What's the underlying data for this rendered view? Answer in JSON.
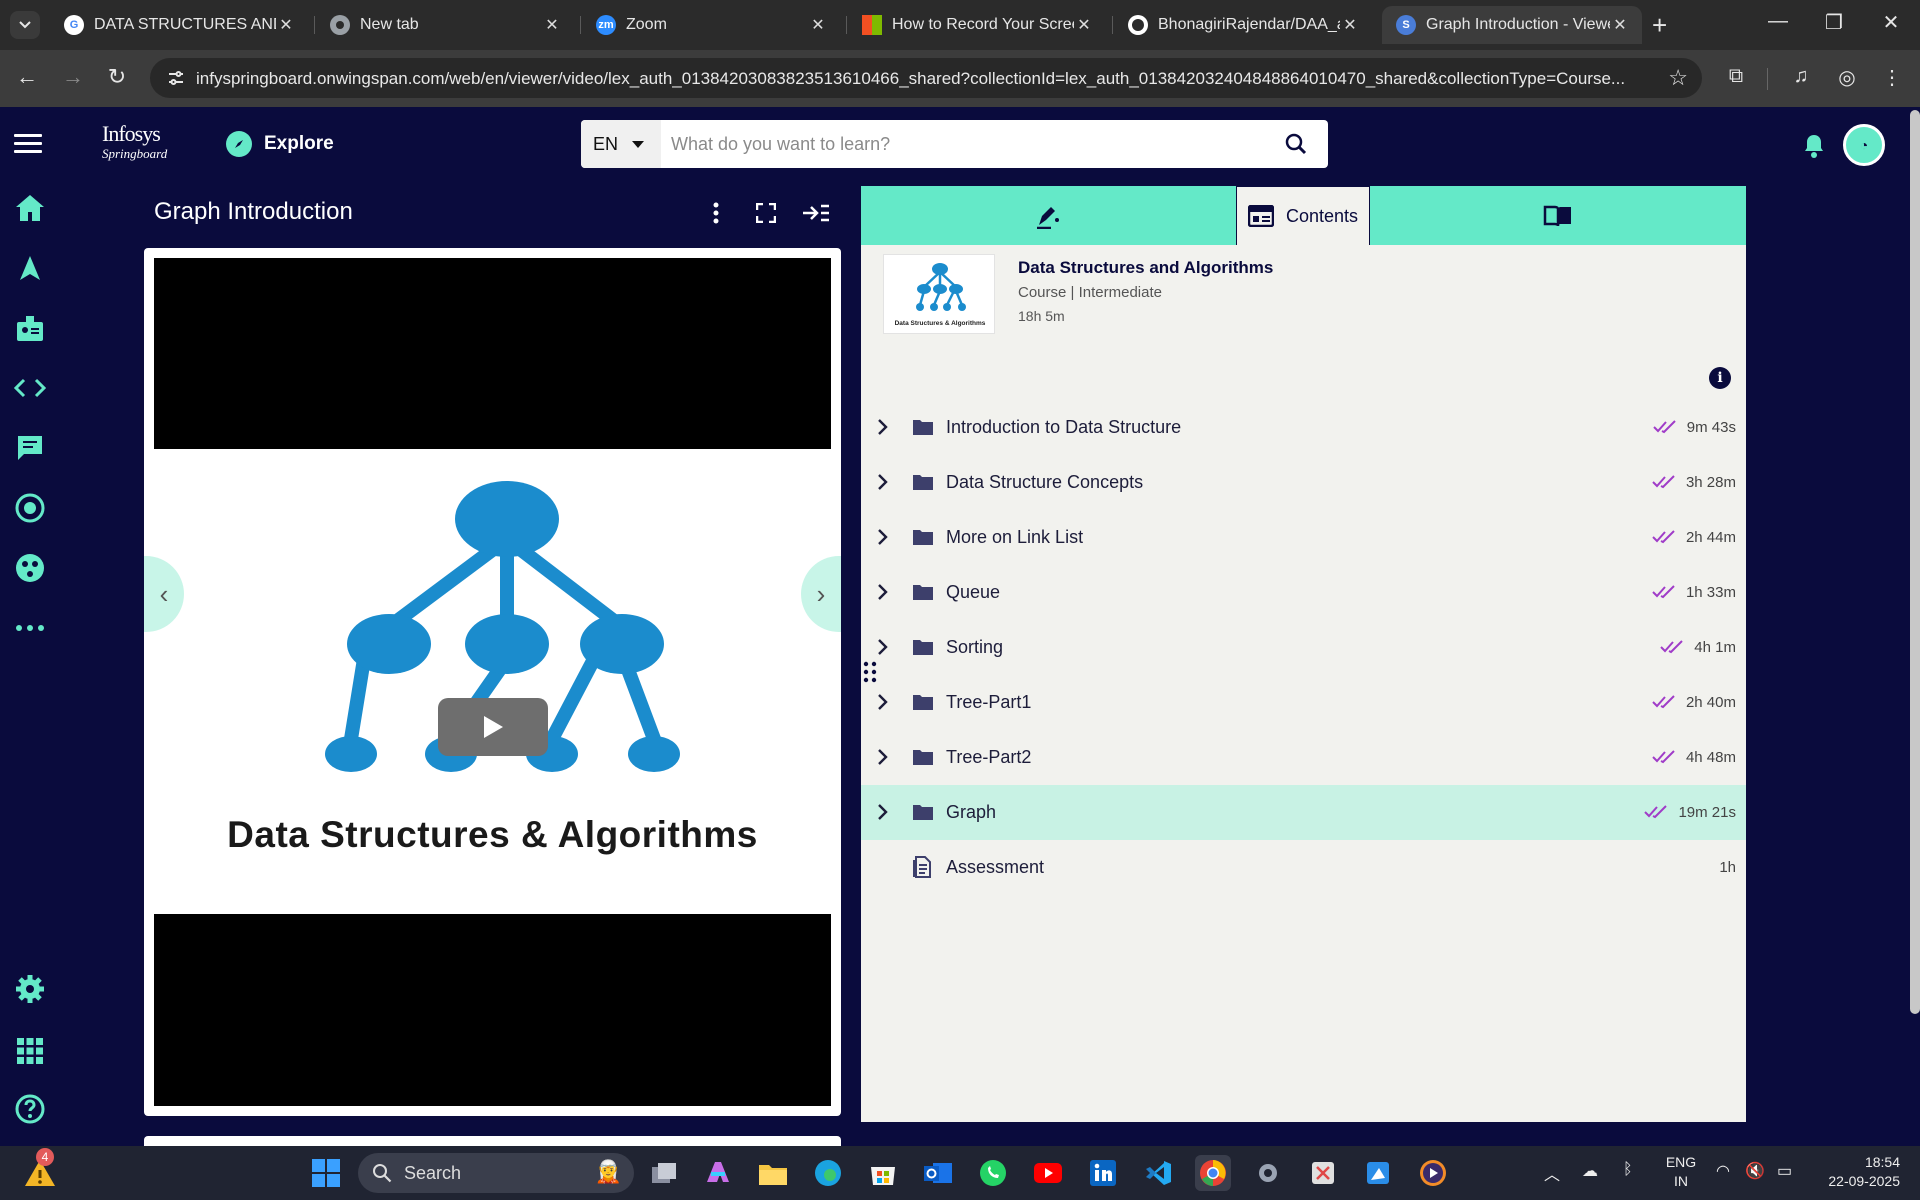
{
  "browser": {
    "tabs": [
      {
        "title": "DATA STRUCTURES AND A",
        "favicon": "google-g-icon"
      },
      {
        "title": "New tab",
        "favicon": "chrome-icon"
      },
      {
        "title": "Zoom",
        "favicon": "zoom-icon",
        "favicon_text": "zm"
      },
      {
        "title": "How to Record Your Screen",
        "favicon": "microsoft-icon"
      },
      {
        "title": "BhonagiriRajendar/DAA_as",
        "favicon": "github-icon"
      },
      {
        "title": "Graph Introduction - Viewer",
        "favicon": "springboard-icon",
        "active": true
      }
    ],
    "url": "infyspringboard.onwingspan.com/web/en/viewer/video/lex_auth_01384203083823513610466_shared?collectionId=lex_auth_013842032404848864010470_shared&collectionType=Course..."
  },
  "header": {
    "logo_line1": "Infosys",
    "logo_line2": "Springboard",
    "explore_label": "Explore",
    "language": "EN",
    "search_placeholder": "What do you want to learn?"
  },
  "player": {
    "title": "Graph Introduction",
    "thumbnail_caption": "Data Structures & Algorithms"
  },
  "panel": {
    "active_tab": "Contents",
    "course": {
      "name": "Data Structures and Algorithms",
      "meta": "Course | Intermediate",
      "duration": "18h 5m",
      "thumb_caption": "Data Structures & Algorithms"
    },
    "modules": [
      {
        "name": "Introduction to Data Structure",
        "duration": "9m 43s",
        "type": "folder",
        "completed": true
      },
      {
        "name": "Data Structure Concepts",
        "duration": "3h 28m",
        "type": "folder",
        "completed": true
      },
      {
        "name": "More on Link List",
        "duration": "2h 44m",
        "type": "folder",
        "completed": true
      },
      {
        "name": "Queue",
        "duration": "1h 33m",
        "type": "folder",
        "completed": true
      },
      {
        "name": "Sorting",
        "duration": "4h 1m",
        "type": "folder",
        "completed": true
      },
      {
        "name": "Tree-Part1",
        "duration": "2h 40m",
        "type": "folder",
        "completed": true
      },
      {
        "name": "Tree-Part2",
        "duration": "4h 48m",
        "type": "folder",
        "completed": true
      },
      {
        "name": "Graph",
        "duration": "19m 21s",
        "type": "folder",
        "completed": true,
        "highlighted": true
      },
      {
        "name": "Assessment",
        "duration": "1h",
        "type": "document",
        "completed": false
      }
    ]
  },
  "taskbar": {
    "search_label": "Search",
    "notification_count": "4",
    "lang_line1": "ENG",
    "lang_line2": "IN",
    "time": "18:54",
    "date": "22-09-2025"
  },
  "colors": {
    "navy": "#0a0b3d",
    "mint": "#64e9c8",
    "highlight_row": "#c8f2e4",
    "check_purple": "#a03cc8"
  }
}
